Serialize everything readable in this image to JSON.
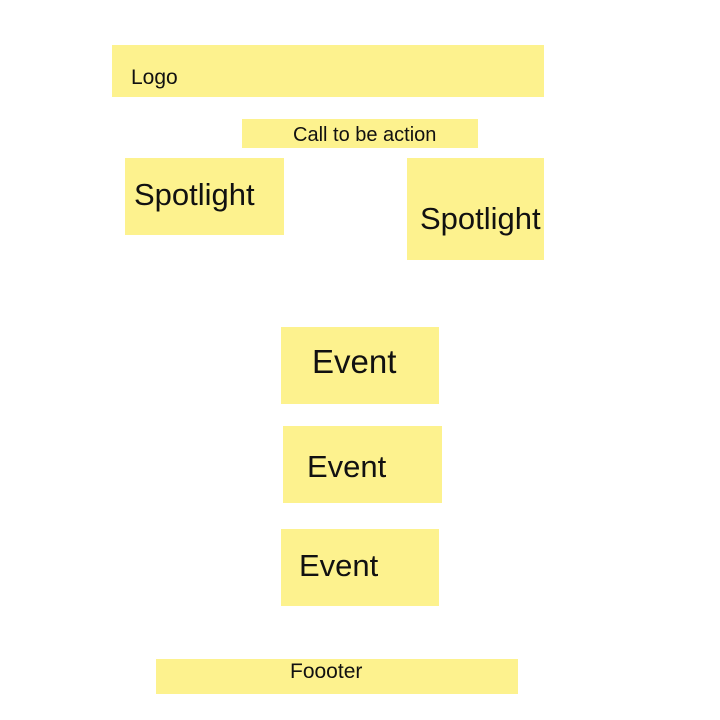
{
  "colors": {
    "note_background": "#fdf28e",
    "page_background": "#ffffff",
    "text": "#111111"
  },
  "header": {
    "logo_label": "Logo"
  },
  "call_to_action": {
    "label": "Call to be action"
  },
  "spotlights": [
    {
      "label": "Spotlight"
    },
    {
      "label": "Spotlight"
    }
  ],
  "events": [
    {
      "label": "Event"
    },
    {
      "label": "Event"
    },
    {
      "label": "Event"
    }
  ],
  "footer": {
    "label": "Foooter"
  }
}
